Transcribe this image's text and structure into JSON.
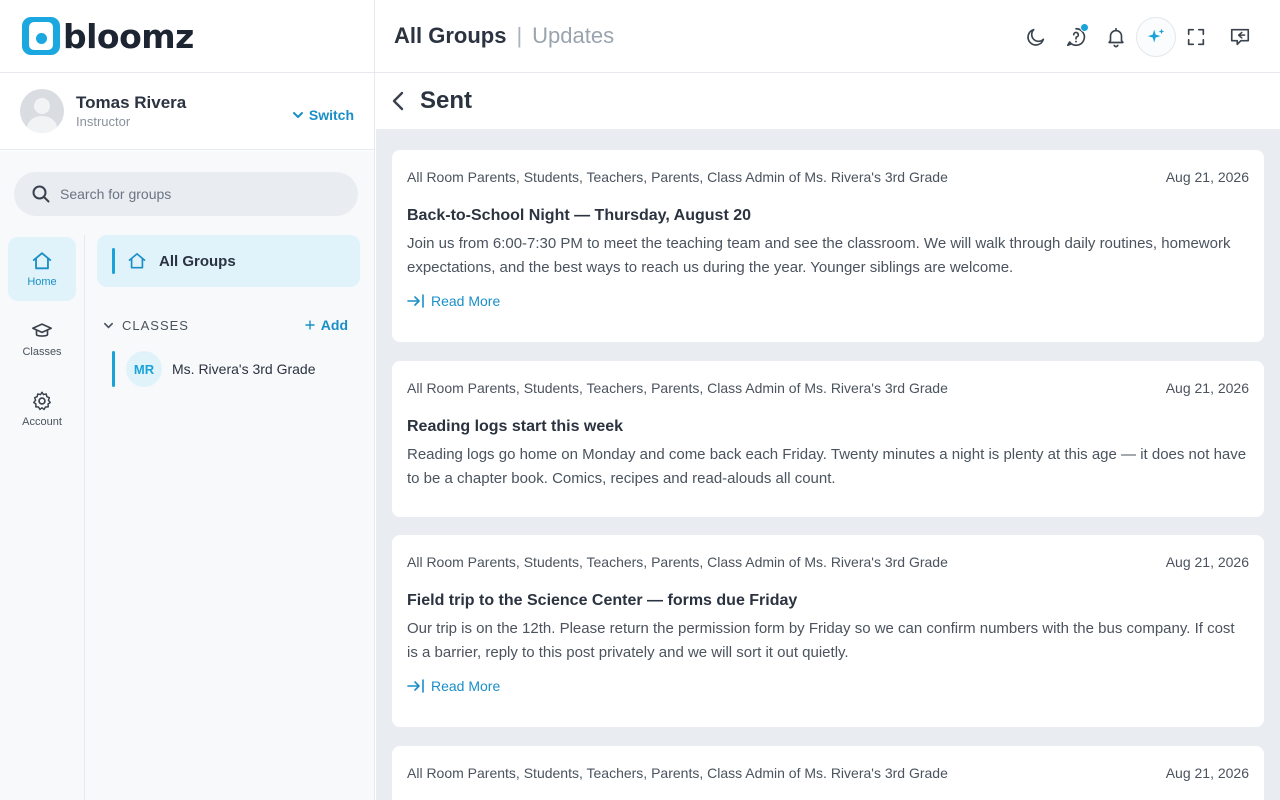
{
  "brand": {
    "name": "bloomz"
  },
  "profile": {
    "name": "Tomas Rivera",
    "role": "Instructor",
    "switch_label": "Switch"
  },
  "search": {
    "placeholder": "Search for groups"
  },
  "rail": [
    {
      "label": "Home",
      "icon": "home-icon",
      "active": true
    },
    {
      "label": "Classes",
      "icon": "graduation-cap-icon"
    },
    {
      "label": "Account",
      "icon": "gear-icon"
    }
  ],
  "groups": {
    "all_groups_label": "All Groups",
    "classes_heading": "CLASSES",
    "add_label": "Add",
    "classes": [
      {
        "initials": "MR",
        "name": "Ms. Rivera's 3rd Grade"
      }
    ]
  },
  "header": {
    "crumb_primary": "All Groups",
    "crumb_separator": "|",
    "crumb_secondary": "Updates"
  },
  "top_icons": [
    "moon-icon",
    "help-icon",
    "bell-icon",
    "sparkle-icon",
    "fullscreen-icon",
    "collapse-panel-icon"
  ],
  "page": {
    "title": "Sent"
  },
  "accent_color": "#1aa3d8",
  "posts": [
    {
      "audience": "All Room Parents, Students, Teachers, Parents, Class Admin of Ms. Rivera's 3rd Grade",
      "date": "Aug 21, 2026",
      "title": "Back-to-School Night — Thursday, August 20",
      "body": "Join us from 6:00-7:30 PM to meet the teaching team and see the classroom. We will walk through daily routines, homework expectations, and the best ways to reach us during the year. Younger siblings are welcome.",
      "read_more": "Read More"
    },
    {
      "audience": "All Room Parents, Students, Teachers, Parents, Class Admin of Ms. Rivera's 3rd Grade",
      "date": "Aug 21, 2026",
      "title": "Reading logs start this week",
      "body": "Reading logs go home on Monday and come back each Friday. Twenty minutes a night is plenty at this age — it does not have to be a chapter book. Comics, recipes and read-alouds all count."
    },
    {
      "audience": "All Room Parents, Students, Teachers, Parents, Class Admin of Ms. Rivera's 3rd Grade",
      "date": "Aug 21, 2026",
      "title": "Field trip to the Science Center — forms due Friday",
      "body": "Our trip is on the 12th. Please return the permission form by Friday so we can confirm numbers with the bus company. If cost is a barrier, reply to this post privately and we will sort it out quietly.",
      "read_more": "Read More"
    },
    {
      "audience": "All Room Parents, Students, Teachers, Parents, Class Admin of Ms. Rivera's 3rd Grade",
      "date": "Aug 21, 2026"
    }
  ]
}
